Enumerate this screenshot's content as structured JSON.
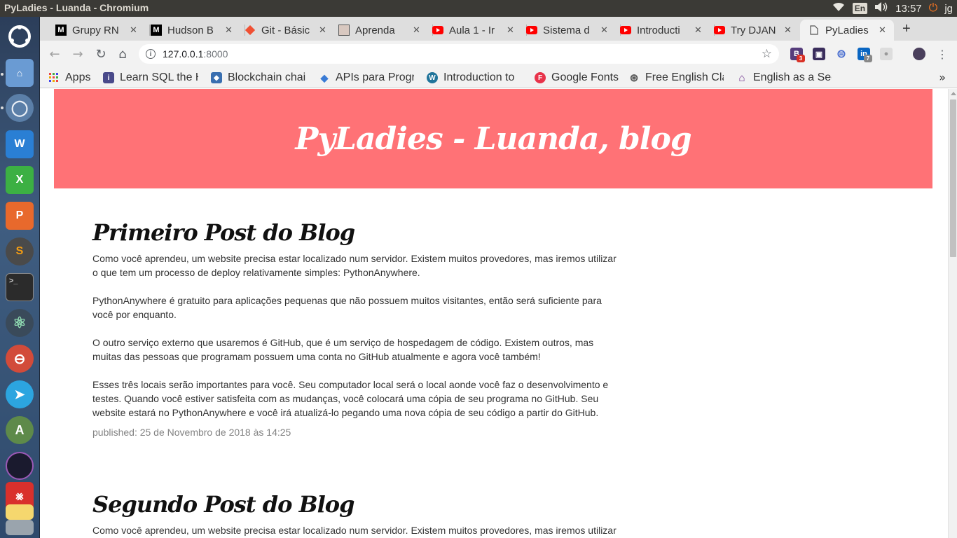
{
  "system": {
    "window_title": "PyLadies - Luanda - Chromium",
    "keyboard_lang": "En",
    "time": "13:57",
    "user": "jg"
  },
  "launcher": {
    "items": [
      "ubuntu-logo",
      "files",
      "chromium",
      "writer",
      "calc",
      "impress",
      "sublime",
      "terminal",
      "atom",
      "help",
      "telegram",
      "android-studio",
      "vpn",
      "acrobat",
      "notes",
      "trash"
    ]
  },
  "tabs": [
    {
      "label": "Grupy RN",
      "favicon": "M"
    },
    {
      "label": "Hudson B",
      "favicon": "M"
    },
    {
      "label": "Git - Básic",
      "favicon": "git"
    },
    {
      "label": "Aprenda",
      "favicon": "person"
    },
    {
      "label": "Aula 1 - Ir",
      "favicon": "youtube"
    },
    {
      "label": "Sistema d",
      "favicon": "youtube"
    },
    {
      "label": "Introducti",
      "favicon": "youtube"
    },
    {
      "label": "Try DJAN",
      "favicon": "youtube"
    },
    {
      "label": "PyLadies",
      "favicon": "page",
      "active": true
    }
  ],
  "toolbar": {
    "url_host": "127.0.0.1",
    "url_port": ":8000",
    "extension_badge_1": "3",
    "extension_badge_2": "7"
  },
  "bookmarks": [
    {
      "label": "Apps",
      "icon": "apps-grid"
    },
    {
      "label": "Learn SQL the H",
      "icon": "book"
    },
    {
      "label": "Blockchain chair",
      "icon": "cube"
    },
    {
      "label": "APIs para Progr",
      "icon": "diamond"
    },
    {
      "label": "Introduction to",
      "icon": "wordpress"
    },
    {
      "label": "Google Fonts",
      "icon": "fonts"
    },
    {
      "label": "Free English Cla",
      "icon": "globe"
    },
    {
      "label": "English as a Sec",
      "icon": "house"
    }
  ],
  "page": {
    "header_title": "PyLadies - Luanda, blog",
    "posts": [
      {
        "title": "Primeiro Post do Blog",
        "paragraphs": [
          "Como você aprendeu, um website precisa estar localizado num servidor. Existem muitos provedores, mas iremos utilizar o que tem um processo de deploy relativamente simples: PythonAnywhere.",
          "PythonAnywhere é gratuito para aplicações pequenas que não possuem muitos visitantes, então será suficiente para você por enquanto.",
          "O outro serviço externo que usaremos é GitHub, que é um serviço de hospedagem de código. Existem outros, mas muitas das pessoas que programam possuem uma conta no GitHub atualmente e agora você também!",
          "Esses três locais serão importantes para você. Seu computador local será o local aonde você faz o desenvolvimento e testes. Quando você estiver satisfeita com as mudanças, você colocará uma cópia de seu programa no GitHub. Seu website estará no PythonAnywhere e você irá atualizá-lo pegando uma nova cópia de seu código a partir do GitHub."
        ],
        "published": "published: 25 de Novembro de 2018 às 14:25"
      },
      {
        "title": "Segundo Post do Blog",
        "paragraphs": [
          "Como você aprendeu, um website precisa estar localizado num servidor. Existem muitos provedores, mas iremos utilizar"
        ]
      }
    ]
  }
}
